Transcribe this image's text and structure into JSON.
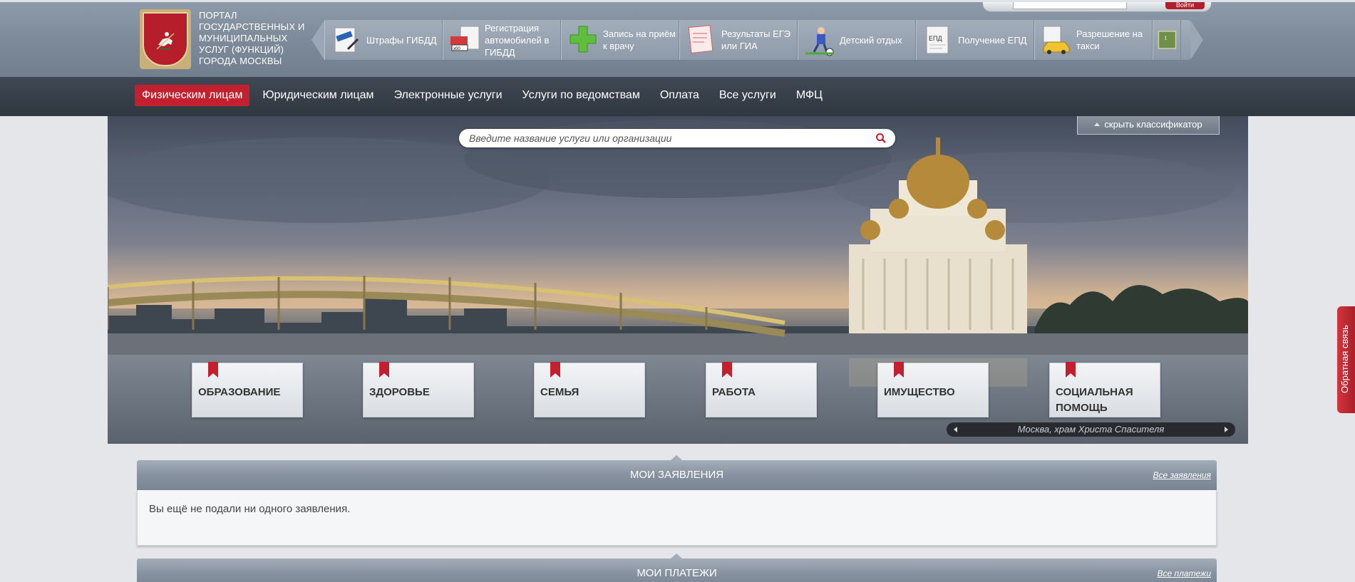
{
  "header": {
    "logo_text": "Портал государственных и муниципальных услуг (функций) города Москвы",
    "login_button": "Войти",
    "quick_links": [
      {
        "label": "Штрафы ГИБДД",
        "icon": "fine-icon"
      },
      {
        "label": "Регистрация автомобилей в ГИБДД",
        "icon": "car-registration-icon"
      },
      {
        "label": "Запись на приём к врачу",
        "icon": "medical-cross-icon"
      },
      {
        "label": "Результаты ЕГЭ или ГИА",
        "icon": "exam-form-icon"
      },
      {
        "label": "Детский отдых",
        "icon": "child-football-icon"
      },
      {
        "label": "Получение ЕПД",
        "icon": "epd-document-icon"
      },
      {
        "label": "Разрешение на такси",
        "icon": "taxi-icon"
      },
      {
        "label": "",
        "icon": "school-icon"
      }
    ]
  },
  "nav": {
    "items": [
      {
        "label": "Физическим лицам",
        "active": true
      },
      {
        "label": "Юридическим лицам",
        "active": false
      },
      {
        "label": "Электронные услуги",
        "active": false
      },
      {
        "label": "Услуги по ведомствам",
        "active": false
      },
      {
        "label": "Оплата",
        "active": false
      },
      {
        "label": "Все услуги",
        "active": false
      },
      {
        "label": "МФЦ",
        "active": false
      }
    ]
  },
  "hero": {
    "search_placeholder": "Введите название услуги или организации",
    "hide_classifier": "скрыть классификатор",
    "caption": "Москва, храм Христа Спасителя",
    "categories": [
      {
        "label": "Образование"
      },
      {
        "label": "Здоровье"
      },
      {
        "label": "Семья"
      },
      {
        "label": "Работа"
      },
      {
        "label": "Имущество"
      },
      {
        "label": "Социальная помощь"
      }
    ]
  },
  "applications": {
    "title": "Мои заявления",
    "link": "Все заявления",
    "message": "Вы ещё не подали ни одного заявления."
  },
  "payments": {
    "title": "Мои платежи",
    "link": "Все платежи"
  },
  "feedback": {
    "label": "Обратная связь"
  },
  "colors": {
    "accent_red": "#c2202f",
    "nav_bg": "#343c46",
    "header_bg": "#7d8a9a"
  }
}
